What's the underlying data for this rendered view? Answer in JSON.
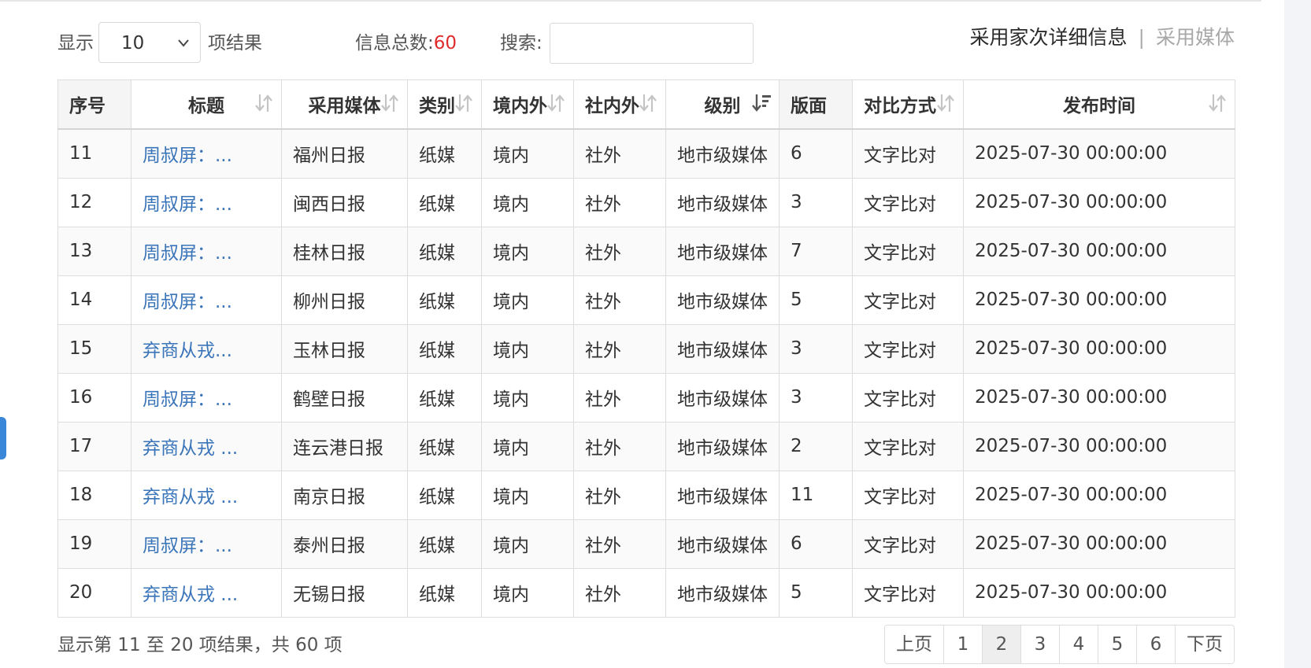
{
  "controls": {
    "show_label": "显示",
    "page_length": "10",
    "results_label": "项结果",
    "total_label": "信息总数:",
    "total_count": "60",
    "search_label": "搜索:",
    "search_value": ""
  },
  "tabs": {
    "active": "采用家次详细信息",
    "separator": "|",
    "inactive": "采用媒体"
  },
  "table": {
    "headers": [
      "序号",
      "标题",
      "采用媒体",
      "类别",
      "境内外",
      "社内外",
      "级别",
      "版面",
      "对比方式",
      "发布时间"
    ],
    "rows": [
      [
        "11",
        "周叔屏：...",
        "福州日报",
        "纸媒",
        "境内",
        "社外",
        "地市级媒体",
        "6",
        "文字比对",
        "2025-07-30 00:00:00"
      ],
      [
        "12",
        "周叔屏：...",
        "闽西日报",
        "纸媒",
        "境内",
        "社外",
        "地市级媒体",
        "3",
        "文字比对",
        "2025-07-30 00:00:00"
      ],
      [
        "13",
        "周叔屏：...",
        "桂林日报",
        "纸媒",
        "境内",
        "社外",
        "地市级媒体",
        "7",
        "文字比对",
        "2025-07-30 00:00:00"
      ],
      [
        "14",
        "周叔屏：...",
        "柳州日报",
        "纸媒",
        "境内",
        "社外",
        "地市级媒体",
        "5",
        "文字比对",
        "2025-07-30 00:00:00"
      ],
      [
        "15",
        "弃商从戎...",
        "玉林日报",
        "纸媒",
        "境内",
        "社外",
        "地市级媒体",
        "3",
        "文字比对",
        "2025-07-30 00:00:00"
      ],
      [
        "16",
        "周叔屏：...",
        "鹤壁日报",
        "纸媒",
        "境内",
        "社外",
        "地市级媒体",
        "3",
        "文字比对",
        "2025-07-30 00:00:00"
      ],
      [
        "17",
        "弃商从戎 ...",
        "连云港日报",
        "纸媒",
        "境内",
        "社外",
        "地市级媒体",
        "2",
        "文字比对",
        "2025-07-30 00:00:00"
      ],
      [
        "18",
        "弃商从戎 ...",
        "南京日报",
        "纸媒",
        "境内",
        "社外",
        "地市级媒体",
        "11",
        "文字比对",
        "2025-07-30 00:00:00"
      ],
      [
        "19",
        "周叔屏：...",
        "泰州日报",
        "纸媒",
        "境内",
        "社外",
        "地市级媒体",
        "6",
        "文字比对",
        "2025-07-30 00:00:00"
      ],
      [
        "20",
        "弃商从戎 ...",
        "无锡日报",
        "纸媒",
        "境内",
        "社外",
        "地市级媒体",
        "5",
        "文字比对",
        "2025-07-30 00:00:00"
      ]
    ]
  },
  "footer": {
    "info": "显示第 11 至 20 项结果，共 60 项"
  },
  "pagination": {
    "prev": "上页",
    "pages": [
      "1",
      "2",
      "3",
      "4",
      "5",
      "6"
    ],
    "current": "2",
    "next": "下页"
  },
  "colors": {
    "link": "#3a74b9",
    "total_count": "#e02b2b",
    "side_tab": "#3a86d8"
  },
  "icons": {
    "sort": "sort-both-icon",
    "sorted_desc": "sort-desc-icon",
    "select": "chevron-down-icon"
  }
}
